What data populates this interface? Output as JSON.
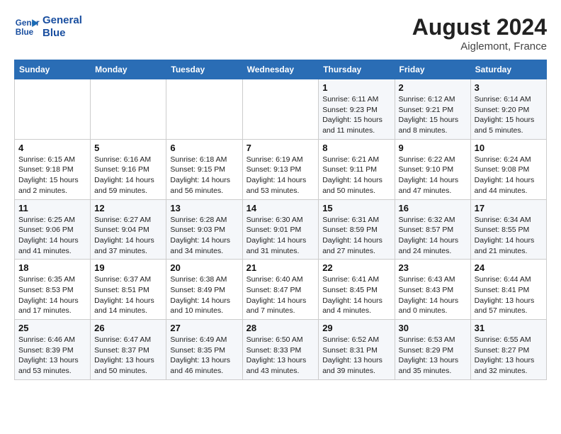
{
  "header": {
    "logo_line1": "General",
    "logo_line2": "Blue",
    "month_year": "August 2024",
    "location": "Aiglemont, France"
  },
  "columns": [
    "Sunday",
    "Monday",
    "Tuesday",
    "Wednesday",
    "Thursday",
    "Friday",
    "Saturday"
  ],
  "weeks": [
    [
      {
        "day": "",
        "info": ""
      },
      {
        "day": "",
        "info": ""
      },
      {
        "day": "",
        "info": ""
      },
      {
        "day": "",
        "info": ""
      },
      {
        "day": "1",
        "info": "Sunrise: 6:11 AM\nSunset: 9:23 PM\nDaylight: 15 hours\nand 11 minutes."
      },
      {
        "day": "2",
        "info": "Sunrise: 6:12 AM\nSunset: 9:21 PM\nDaylight: 15 hours\nand 8 minutes."
      },
      {
        "day": "3",
        "info": "Sunrise: 6:14 AM\nSunset: 9:20 PM\nDaylight: 15 hours\nand 5 minutes."
      }
    ],
    [
      {
        "day": "4",
        "info": "Sunrise: 6:15 AM\nSunset: 9:18 PM\nDaylight: 15 hours\nand 2 minutes."
      },
      {
        "day": "5",
        "info": "Sunrise: 6:16 AM\nSunset: 9:16 PM\nDaylight: 14 hours\nand 59 minutes."
      },
      {
        "day": "6",
        "info": "Sunrise: 6:18 AM\nSunset: 9:15 PM\nDaylight: 14 hours\nand 56 minutes."
      },
      {
        "day": "7",
        "info": "Sunrise: 6:19 AM\nSunset: 9:13 PM\nDaylight: 14 hours\nand 53 minutes."
      },
      {
        "day": "8",
        "info": "Sunrise: 6:21 AM\nSunset: 9:11 PM\nDaylight: 14 hours\nand 50 minutes."
      },
      {
        "day": "9",
        "info": "Sunrise: 6:22 AM\nSunset: 9:10 PM\nDaylight: 14 hours\nand 47 minutes."
      },
      {
        "day": "10",
        "info": "Sunrise: 6:24 AM\nSunset: 9:08 PM\nDaylight: 14 hours\nand 44 minutes."
      }
    ],
    [
      {
        "day": "11",
        "info": "Sunrise: 6:25 AM\nSunset: 9:06 PM\nDaylight: 14 hours\nand 41 minutes."
      },
      {
        "day": "12",
        "info": "Sunrise: 6:27 AM\nSunset: 9:04 PM\nDaylight: 14 hours\nand 37 minutes."
      },
      {
        "day": "13",
        "info": "Sunrise: 6:28 AM\nSunset: 9:03 PM\nDaylight: 14 hours\nand 34 minutes."
      },
      {
        "day": "14",
        "info": "Sunrise: 6:30 AM\nSunset: 9:01 PM\nDaylight: 14 hours\nand 31 minutes."
      },
      {
        "day": "15",
        "info": "Sunrise: 6:31 AM\nSunset: 8:59 PM\nDaylight: 14 hours\nand 27 minutes."
      },
      {
        "day": "16",
        "info": "Sunrise: 6:32 AM\nSunset: 8:57 PM\nDaylight: 14 hours\nand 24 minutes."
      },
      {
        "day": "17",
        "info": "Sunrise: 6:34 AM\nSunset: 8:55 PM\nDaylight: 14 hours\nand 21 minutes."
      }
    ],
    [
      {
        "day": "18",
        "info": "Sunrise: 6:35 AM\nSunset: 8:53 PM\nDaylight: 14 hours\nand 17 minutes."
      },
      {
        "day": "19",
        "info": "Sunrise: 6:37 AM\nSunset: 8:51 PM\nDaylight: 14 hours\nand 14 minutes."
      },
      {
        "day": "20",
        "info": "Sunrise: 6:38 AM\nSunset: 8:49 PM\nDaylight: 14 hours\nand 10 minutes."
      },
      {
        "day": "21",
        "info": "Sunrise: 6:40 AM\nSunset: 8:47 PM\nDaylight: 14 hours\nand 7 minutes."
      },
      {
        "day": "22",
        "info": "Sunrise: 6:41 AM\nSunset: 8:45 PM\nDaylight: 14 hours\nand 4 minutes."
      },
      {
        "day": "23",
        "info": "Sunrise: 6:43 AM\nSunset: 8:43 PM\nDaylight: 14 hours\nand 0 minutes."
      },
      {
        "day": "24",
        "info": "Sunrise: 6:44 AM\nSunset: 8:41 PM\nDaylight: 13 hours\nand 57 minutes."
      }
    ],
    [
      {
        "day": "25",
        "info": "Sunrise: 6:46 AM\nSunset: 8:39 PM\nDaylight: 13 hours\nand 53 minutes."
      },
      {
        "day": "26",
        "info": "Sunrise: 6:47 AM\nSunset: 8:37 PM\nDaylight: 13 hours\nand 50 minutes."
      },
      {
        "day": "27",
        "info": "Sunrise: 6:49 AM\nSunset: 8:35 PM\nDaylight: 13 hours\nand 46 minutes."
      },
      {
        "day": "28",
        "info": "Sunrise: 6:50 AM\nSunset: 8:33 PM\nDaylight: 13 hours\nand 43 minutes."
      },
      {
        "day": "29",
        "info": "Sunrise: 6:52 AM\nSunset: 8:31 PM\nDaylight: 13 hours\nand 39 minutes."
      },
      {
        "day": "30",
        "info": "Sunrise: 6:53 AM\nSunset: 8:29 PM\nDaylight: 13 hours\nand 35 minutes."
      },
      {
        "day": "31",
        "info": "Sunrise: 6:55 AM\nSunset: 8:27 PM\nDaylight: 13 hours\nand 32 minutes."
      }
    ]
  ]
}
